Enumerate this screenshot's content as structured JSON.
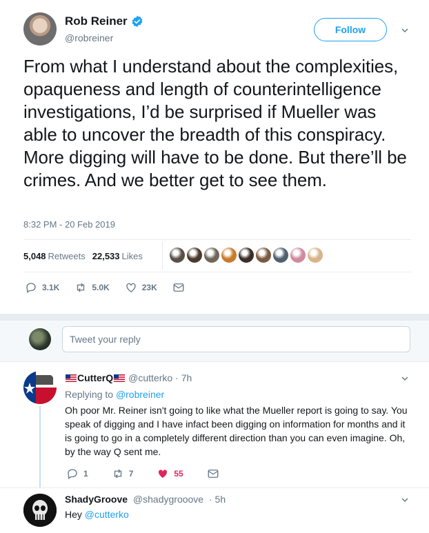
{
  "tweet": {
    "display_name": "Rob Reiner",
    "handle": "@robreiner",
    "follow_label": "Follow",
    "text": "From what I understand about the complexities, opaqueness and length of counterintelligence investigations, I’d be surprised if Mueller was able to uncover the breadth of this conspiracy. More digging will have to be done. But there’ll be crimes. And we better get to see them.",
    "timestamp": "8:32 PM - 20 Feb 2019",
    "retweets_count": "5,048",
    "retweets_label": "Retweets",
    "likes_count": "22,533",
    "likes_label": "Likes",
    "actions": {
      "replies": "3.1K",
      "retweets": "5.0K",
      "likes": "23K"
    },
    "liker_colors": [
      "#5a5048",
      "#4a3a2a",
      "#6e6658",
      "#c97a2a",
      "#3a2e28",
      "#7a5a40",
      "#506070",
      "#d08aa0",
      "#d9b38a"
    ]
  },
  "reply_box": {
    "placeholder": "Tweet your reply"
  },
  "replies": [
    {
      "name": "CutterQ",
      "handle": "@cutterko",
      "time": "· 7h",
      "replying_prefix": "Replying to",
      "replying_to": "@robreiner",
      "text": "Oh poor Mr. Reiner isn't going to like what the Mueller report is going to say. You speak of digging and I have infact been digging on information for months and it is going to go in a completely different direction than you can even imagine.   Oh, by the way Q sent me.",
      "replies": "1",
      "retweets": "7",
      "likes": "55"
    },
    {
      "name": "ShadyGroove",
      "handle": "@shadygrooove",
      "time": "· 5h",
      "text_prefix": "Hey",
      "mention": "@cutterko"
    }
  ],
  "colors": {
    "accent": "#1da1f2",
    "like": "#e0245e",
    "muted": "#657786",
    "text": "#14171a"
  }
}
